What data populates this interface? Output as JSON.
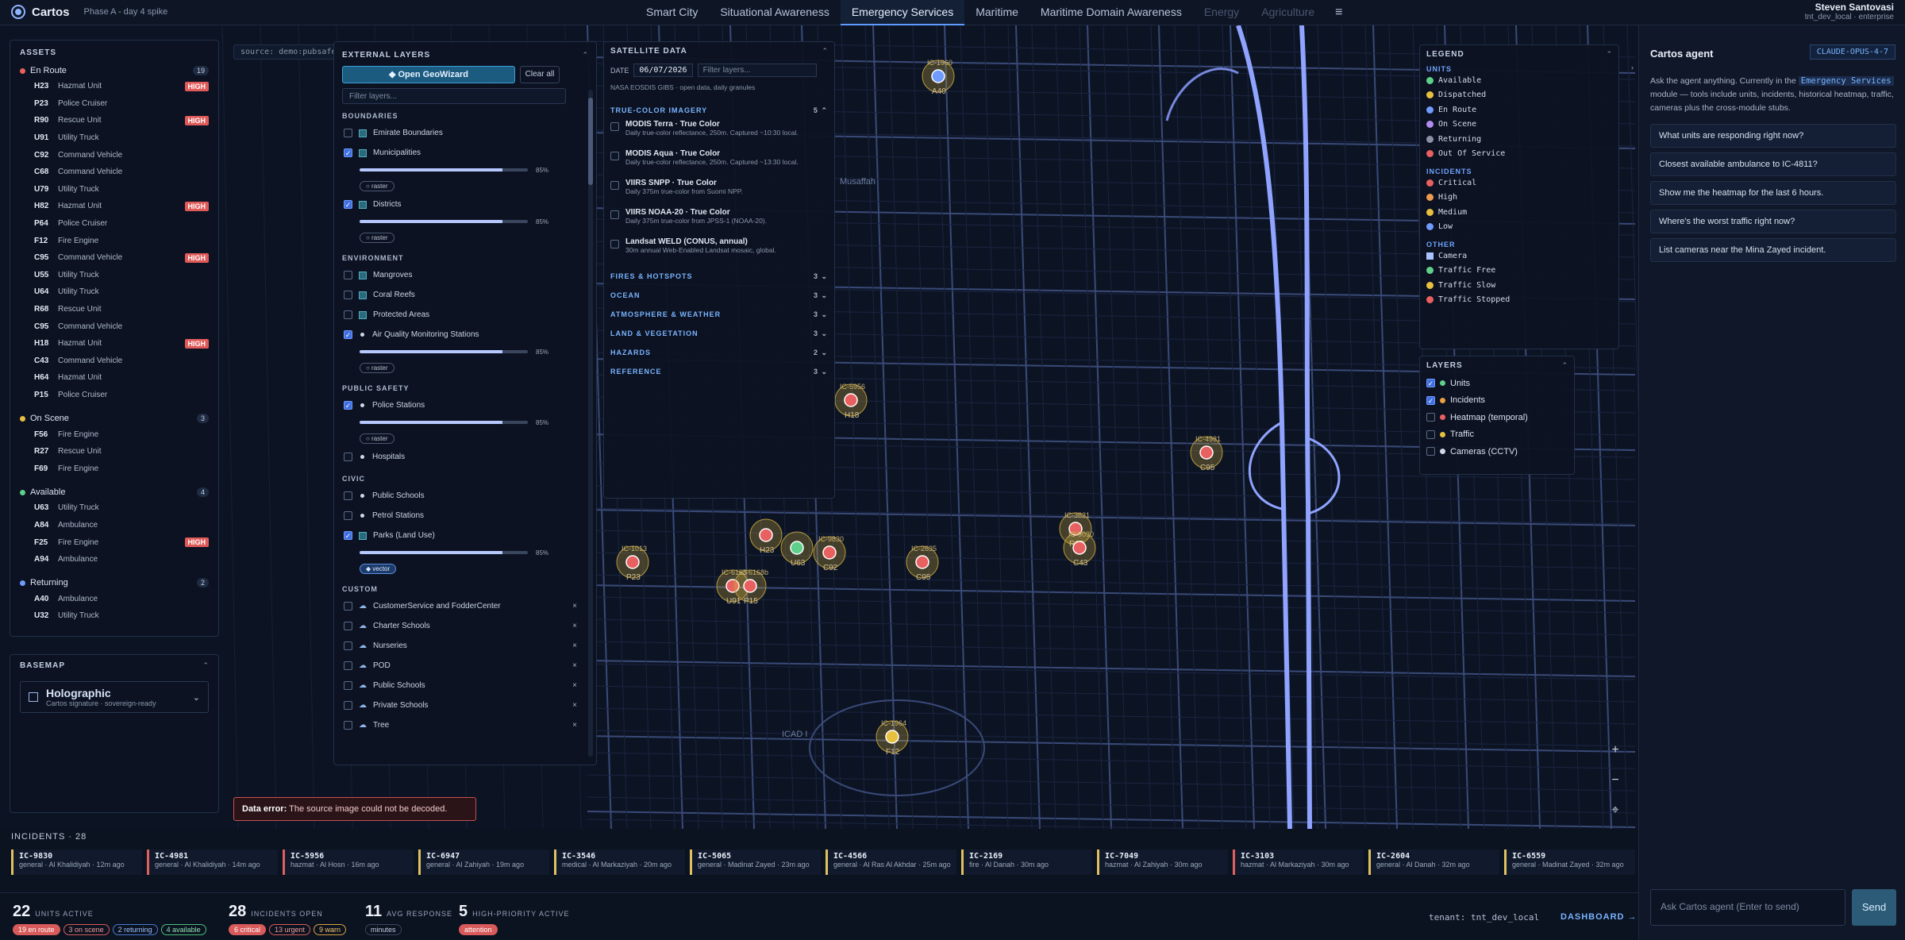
{
  "app": {
    "name": "Cartos",
    "phase": "Phase A - day 4 spike"
  },
  "nav": {
    "tabs": [
      "Smart City",
      "Situational Awareness",
      "Emergency Services",
      "Maritime",
      "Maritime Domain Awareness",
      "Energy",
      "Agriculture"
    ],
    "active": "Emergency Services",
    "menu_icon": "hamburger-icon"
  },
  "user": {
    "name": "Steven Santovasi",
    "org": "tnt_dev_local · enterprise"
  },
  "source": "source: demo:pubsafe",
  "assets": {
    "title": "ASSETS",
    "groups": [
      {
        "name": "En Route",
        "count": "19",
        "color": "#e86060",
        "items": [
          {
            "code": "H23",
            "type": "Hazmat Unit",
            "badge": "HIGH"
          },
          {
            "code": "P23",
            "type": "Police Cruiser",
            "badge": ""
          },
          {
            "code": "R90",
            "type": "Rescue Unit",
            "badge": "HIGH"
          },
          {
            "code": "U91",
            "type": "Utility Truck",
            "badge": ""
          },
          {
            "code": "C92",
            "type": "Command Vehicle",
            "badge": ""
          },
          {
            "code": "C68",
            "type": "Command Vehicle",
            "badge": ""
          },
          {
            "code": "U79",
            "type": "Utility Truck",
            "badge": ""
          },
          {
            "code": "H82",
            "type": "Hazmat Unit",
            "badge": "HIGH"
          },
          {
            "code": "P64",
            "type": "Police Cruiser",
            "badge": ""
          },
          {
            "code": "F12",
            "type": "Fire Engine",
            "badge": ""
          },
          {
            "code": "C95",
            "type": "Command Vehicle",
            "badge": "HIGH"
          },
          {
            "code": "U55",
            "type": "Utility Truck",
            "badge": ""
          },
          {
            "code": "U64",
            "type": "Utility Truck",
            "badge": ""
          },
          {
            "code": "R68",
            "type": "Rescue Unit",
            "badge": ""
          },
          {
            "code": "C95",
            "type": "Command Vehicle",
            "badge": ""
          },
          {
            "code": "H18",
            "type": "Hazmat Unit",
            "badge": "HIGH"
          },
          {
            "code": "C43",
            "type": "Command Vehicle",
            "badge": ""
          },
          {
            "code": "H64",
            "type": "Hazmat Unit",
            "badge": ""
          },
          {
            "code": "P15",
            "type": "Police Cruiser",
            "badge": ""
          }
        ]
      },
      {
        "name": "On Scene",
        "count": "3",
        "color": "#e8c040",
        "items": [
          {
            "code": "F56",
            "type": "Fire Engine",
            "badge": ""
          },
          {
            "code": "R27",
            "type": "Rescue Unit",
            "badge": ""
          },
          {
            "code": "F69",
            "type": "Fire Engine",
            "badge": ""
          }
        ]
      },
      {
        "name": "Available",
        "count": "4",
        "color": "#5fd08a",
        "items": [
          {
            "code": "U63",
            "type": "Utility Truck",
            "badge": ""
          },
          {
            "code": "A84",
            "type": "Ambulance",
            "badge": ""
          },
          {
            "code": "F25",
            "type": "Fire Engine",
            "badge": "HIGH"
          },
          {
            "code": "A94",
            "type": "Ambulance",
            "badge": ""
          }
        ]
      },
      {
        "name": "Returning",
        "count": "2",
        "color": "#6f9bff",
        "items": [
          {
            "code": "A40",
            "type": "Ambulance",
            "badge": ""
          },
          {
            "code": "U32",
            "type": "Utility Truck",
            "badge": ""
          }
        ]
      }
    ]
  },
  "basemap": {
    "title": "BASEMAP",
    "name": "Holographic",
    "desc": "Cartos signature · sovereign-ready"
  },
  "external": {
    "title": "EXTERNAL LAYERS",
    "geowizard": "◆ Open GeoWizard",
    "clear": "Clear all",
    "filter_placeholder": "Filter layers...",
    "sections": [
      {
        "name": "BOUNDARIES",
        "rows": [
          {
            "label": "Emirate Boundaries",
            "on": false,
            "icon": "square"
          },
          {
            "label": "Municipalities",
            "on": true,
            "icon": "square",
            "pct": "85%",
            "pill": "○ raster"
          },
          {
            "label": "Districts",
            "on": true,
            "icon": "square",
            "pct": "85%",
            "pill": "○ raster"
          }
        ]
      },
      {
        "name": "ENVIRONMENT",
        "rows": [
          {
            "label": "Mangroves",
            "on": false,
            "icon": "square"
          },
          {
            "label": "Coral Reefs",
            "on": false,
            "icon": "square"
          },
          {
            "label": "Protected Areas",
            "on": false,
            "icon": "square"
          },
          {
            "label": "Air Quality Monitoring Stations",
            "on": true,
            "icon": "dot",
            "pct": "85%",
            "pill": "○ raster"
          }
        ]
      },
      {
        "name": "PUBLIC SAFETY",
        "rows": [
          {
            "label": "Police Stations",
            "on": true,
            "icon": "dot",
            "pct": "85%",
            "pill": "○ raster"
          },
          {
            "label": "Hospitals",
            "on": false,
            "icon": "dot"
          }
        ]
      },
      {
        "name": "CIVIC",
        "rows": [
          {
            "label": "Public Schools",
            "on": false,
            "icon": "dot"
          },
          {
            "label": "Petrol Stations",
            "on": false,
            "icon": "dot"
          },
          {
            "label": "Parks (Land Use)",
            "on": true,
            "icon": "square",
            "pct": "85%",
            "pill": "◆ vector"
          }
        ]
      },
      {
        "name": "CUSTOM",
        "rows": [
          {
            "label": "CustomerService and FodderCenter",
            "on": false,
            "icon": "cloud",
            "x": "×"
          },
          {
            "label": "Charter Schools",
            "on": false,
            "icon": "cloud",
            "x": "×"
          },
          {
            "label": "Nurseries",
            "on": false,
            "icon": "cloud",
            "x": "×"
          },
          {
            "label": "POD",
            "on": false,
            "icon": "cloud",
            "x": "×"
          },
          {
            "label": "Public Schools",
            "on": false,
            "icon": "cloud",
            "x": "×"
          },
          {
            "label": "Private Schools",
            "on": false,
            "icon": "cloud",
            "x": "×"
          },
          {
            "label": "Tree",
            "on": false,
            "icon": "cloud",
            "x": "×"
          }
        ]
      }
    ]
  },
  "satellite": {
    "title": "SATELLITE DATA",
    "date_label": "DATE",
    "date": "06/07/2026",
    "filter_placeholder": "Filter layers...",
    "note": "NASA EOSDIS GIBS · open data, daily granules",
    "open_cat": {
      "name": "TRUE-COLOR IMAGERY",
      "count": "5"
    },
    "items": [
      {
        "title": "MODIS Terra · True Color",
        "sub": "Daily true-color reflectance, 250m. Captured ~10:30 local."
      },
      {
        "title": "MODIS Aqua · True Color",
        "sub": "Daily true-color reflectance, 250m. Captured ~13:30 local."
      },
      {
        "title": "VIIRS SNPP · True Color",
        "sub": "Daily 375m true-color from Suomi NPP."
      },
      {
        "title": "VIIRS NOAA-20 · True Color",
        "sub": "Daily 375m true-color from JPSS-1 (NOAA-20)."
      },
      {
        "title": "Landsat WELD (CONUS, annual)",
        "sub": "30m annual Web-Enabled Landsat mosaic, global."
      }
    ],
    "cats": [
      {
        "name": "FIRES & HOTSPOTS",
        "count": "3"
      },
      {
        "name": "OCEAN",
        "count": "3"
      },
      {
        "name": "ATMOSPHERE & WEATHER",
        "count": "3"
      },
      {
        "name": "LAND & VEGETATION",
        "count": "3"
      },
      {
        "name": "HAZARDS",
        "count": "2"
      },
      {
        "name": "REFERENCE",
        "count": "3"
      }
    ]
  },
  "legend": {
    "title": "LEGEND",
    "sections": [
      {
        "name": "UNITS",
        "rows": [
          {
            "label": "Available",
            "color": "#5fd08a"
          },
          {
            "label": "Dispatched",
            "color": "#e8c040"
          },
          {
            "label": "En Route",
            "color": "#6f9bff"
          },
          {
            "label": "On Scene",
            "color": "#b08cf0"
          },
          {
            "label": "Returning",
            "color": "#8a93a5"
          },
          {
            "label": "Out Of Service",
            "color": "#e86060"
          }
        ]
      },
      {
        "name": "INCIDENTS",
        "rows": [
          {
            "label": "Critical",
            "color": "#e86060"
          },
          {
            "label": "High",
            "color": "#ee9a50"
          },
          {
            "label": "Medium",
            "color": "#e8c040"
          },
          {
            "label": "Low",
            "color": "#6f9bff"
          }
        ]
      },
      {
        "name": "OTHER",
        "rows": [
          {
            "label": "Camera",
            "color": "#a9c4ff",
            "shape": "square"
          },
          {
            "label": "Traffic Free",
            "color": "#5fd08a"
          },
          {
            "label": "Traffic Slow",
            "color": "#e8c040"
          },
          {
            "label": "Traffic Stopped",
            "color": "#e86060"
          }
        ]
      }
    ]
  },
  "layers": {
    "title": "LAYERS",
    "rows": [
      {
        "label": "Units",
        "on": true,
        "color": "#5fd08a"
      },
      {
        "label": "Incidents",
        "on": true,
        "color": "#e8a040"
      },
      {
        "label": "Heatmap (temporal)",
        "on": false,
        "color": "#e86060"
      },
      {
        "label": "Traffic",
        "on": false,
        "color": "#e8c040"
      },
      {
        "label": "Cameras (CCTV)",
        "on": false,
        "color": "#cfd8e8"
      }
    ]
  },
  "map_labels": {
    "musaffah": "Musaffah",
    "icad": "ICAD I"
  },
  "markers": [
    {
      "id": "IC-1960",
      "unit": "A40"
    },
    {
      "id": "IC-5956",
      "unit": "H18"
    },
    {
      "id": "IC-4981",
      "unit": "C95"
    },
    {
      "id": "IC-3621",
      "unit": "R27"
    },
    {
      "id": "IC-9030",
      "unit": "C43"
    },
    {
      "id": "IC-1013",
      "unit": "P23"
    },
    {
      "id": "IC-6168",
      "unit": "U91"
    },
    {
      "id": "IC-6168b",
      "unit": "P15"
    },
    {
      "id": "IC-9830",
      "unit": "C92"
    },
    {
      "id": "IC-2635",
      "unit": "C95"
    },
    {
      "id": "IC-1964",
      "unit": "F12"
    },
    {
      "id": "",
      "unit": "H23"
    },
    {
      "id": "",
      "unit": "U63"
    }
  ],
  "error": {
    "label": "Data error:",
    "msg": "The source image could not be decoded."
  },
  "zoom": {
    "in": "+",
    "out": "−",
    "locate": "⌖"
  },
  "incidents": {
    "title": "INCIDENTS · 28",
    "items": [
      {
        "id": "IC-9830",
        "meta": "general · Al Khalidiyah · 12m ago",
        "sev": "med"
      },
      {
        "id": "IC-4981",
        "meta": "general · Al Khalidiyah · 14m ago",
        "sev": "crit"
      },
      {
        "id": "IC-5956",
        "meta": "hazmat · Al Hosn · 16m ago",
        "sev": "crit"
      },
      {
        "id": "IC-6947",
        "meta": "general · Al Zahiyah · 19m ago",
        "sev": "med"
      },
      {
        "id": "IC-3546",
        "meta": "medical · Al Markaziyah · 20m ago",
        "sev": "med"
      },
      {
        "id": "IC-5065",
        "meta": "general · Madinat Zayed · 23m ago",
        "sev": "med"
      },
      {
        "id": "IC-4566",
        "meta": "general · Al Ras Al Akhdar · 25m ago",
        "sev": "med"
      },
      {
        "id": "IC-2169",
        "meta": "fire · Al Danah · 30m ago",
        "sev": "med"
      },
      {
        "id": "IC-7049",
        "meta": "hazmat · Al Zahiyah · 30m ago",
        "sev": "med"
      },
      {
        "id": "IC-3103",
        "meta": "hazmat · Al Markaziyah · 30m ago",
        "sev": "crit"
      },
      {
        "id": "IC-2604",
        "meta": "general · Al Danah · 32m ago",
        "sev": "med"
      },
      {
        "id": "IC-6559",
        "meta": "general · Madinat Zayed · 32m ago",
        "sev": "med"
      }
    ]
  },
  "stats": {
    "units": {
      "n": "22",
      "label": "UNITS ACTIVE",
      "chips": [
        "19 en route",
        "3 on scene",
        "2 returning",
        "4 available"
      ]
    },
    "incidents": {
      "n": "28",
      "label": "INCIDENTS OPEN",
      "chips": [
        "6 critical",
        "13 urgent",
        "9 warn"
      ]
    },
    "response": {
      "n": "11",
      "label": "AVG RESPONSE",
      "chips": [
        "minutes"
      ]
    },
    "priority": {
      "n": "5",
      "label": "HIGH-PRIORITY ACTIVE",
      "chips": [
        "attention"
      ]
    },
    "tenant": "tenant: tnt_dev_local",
    "dashboard": "DASHBOARD →"
  },
  "agent": {
    "title": "Cartos agent",
    "model": "CLAUDE-OPUS-4-7",
    "intro_a": "Ask the agent anything. Currently in the ",
    "intro_hl": "Emergency Services",
    "intro_b": " module — tools include units, incidents, historical heatmap, traffic, cameras plus the cross-module stubs.",
    "suggestions": [
      "What units are responding right now?",
      "Closest available ambulance to IC-4811?",
      "Show me the heatmap for the last 6 hours.",
      "Where's the worst traffic right now?",
      "List cameras near the Mina Zayed incident."
    ],
    "input_placeholder": "Ask Cartos agent (Enter to send)",
    "send": "Send"
  }
}
